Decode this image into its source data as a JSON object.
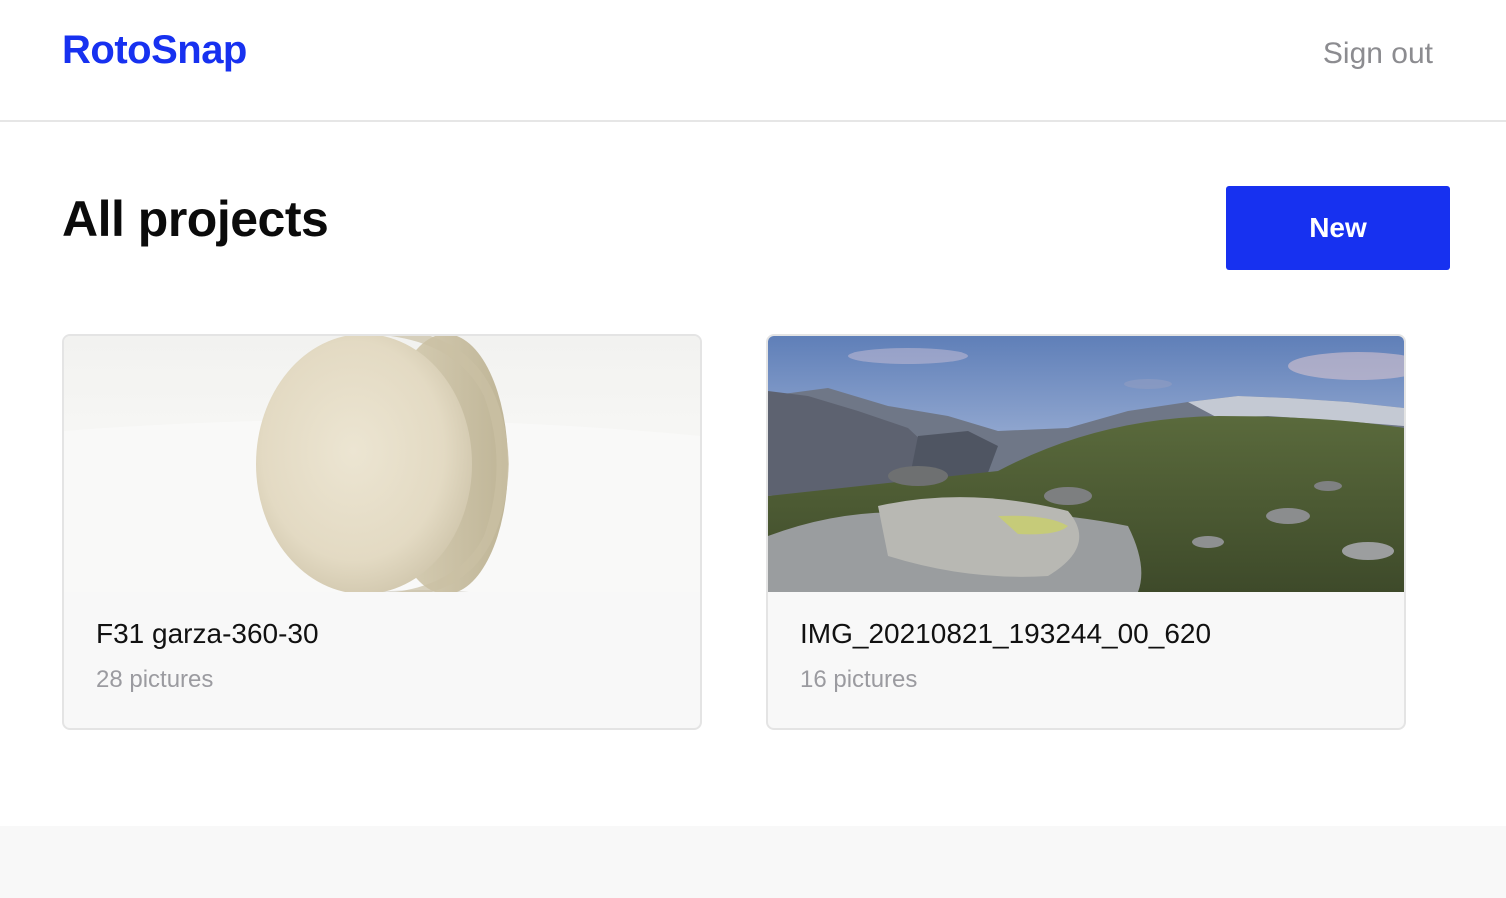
{
  "header": {
    "logo": "RotoSnap",
    "sign_out": "Sign out"
  },
  "main": {
    "title": "All projects",
    "new_button": "New"
  },
  "projects": [
    {
      "name": "F31 garza-360-30",
      "count": "28 pictures",
      "thumbnail": "white-stone-disc-photo"
    },
    {
      "name": "IMG_20210821_193244_00_620",
      "count": "16 pictures",
      "thumbnail": "mountain-panorama-photo"
    }
  ],
  "colors": {
    "accent": "#1731f0",
    "muted_text": "#9b9ba0",
    "card_background": "#f8f8f8"
  }
}
